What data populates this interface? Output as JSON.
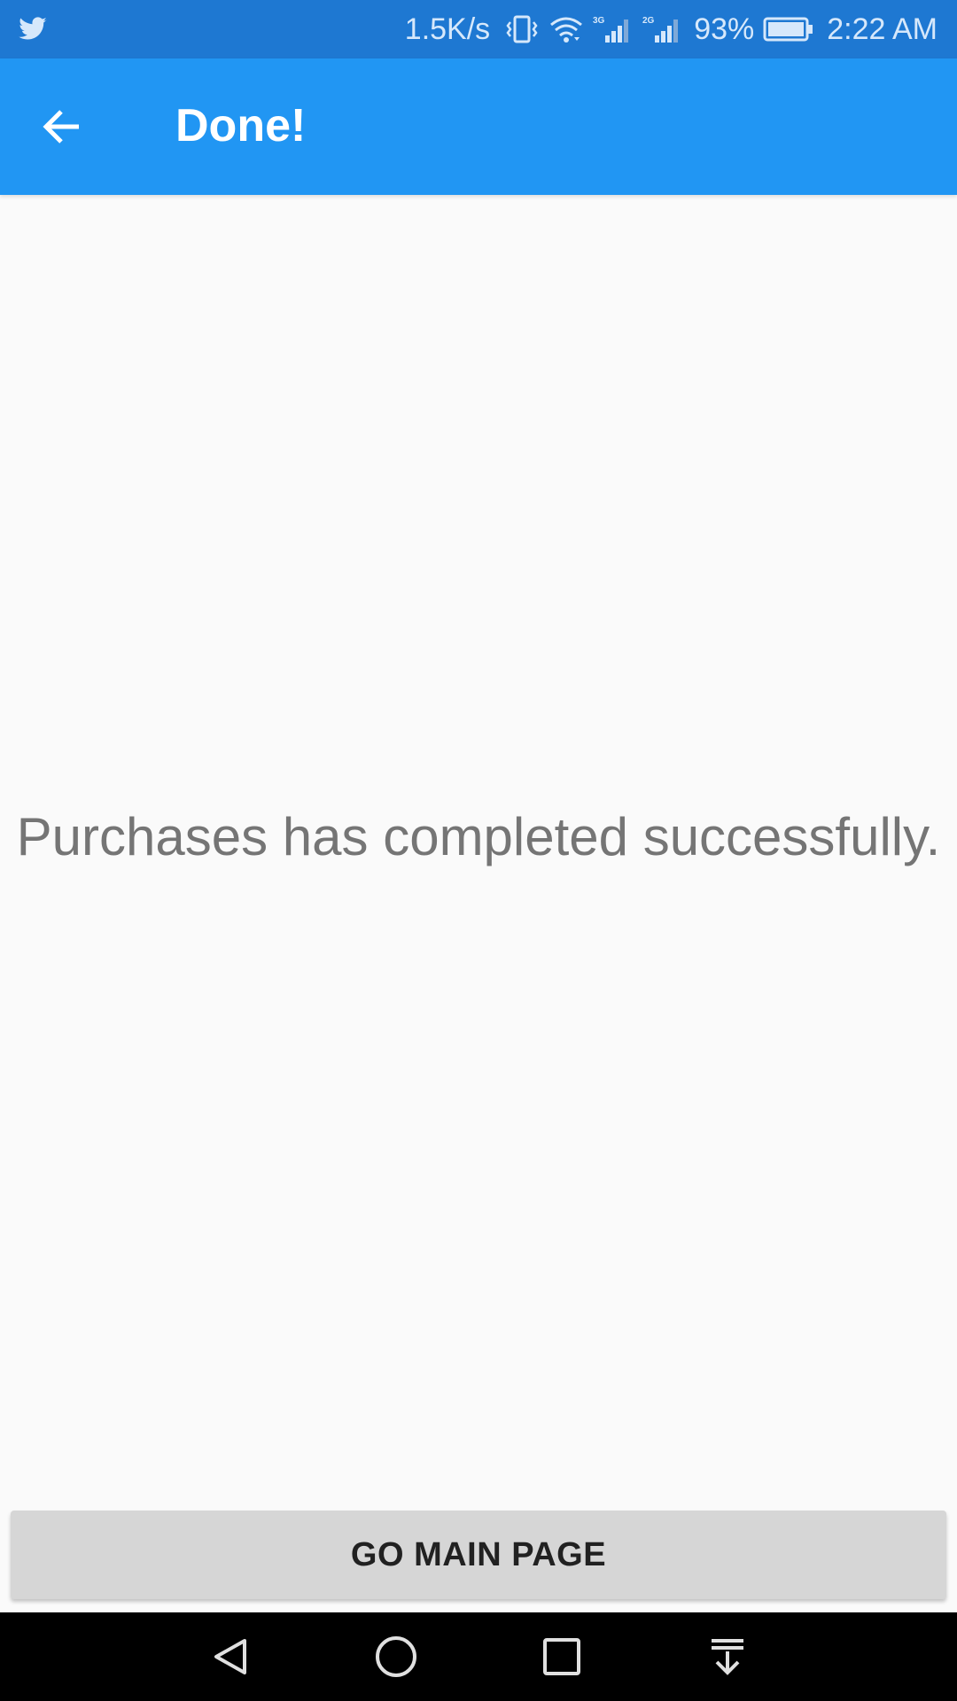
{
  "status_bar": {
    "net_speed": "1.5K/s",
    "sim1_label": "3G",
    "sim2_label": "2G",
    "battery": "93%",
    "time": "2:22 AM",
    "icons": [
      "twitter-icon",
      "vibrate-icon",
      "wifi-icon",
      "signal-icon",
      "battery-icon"
    ]
  },
  "app_bar": {
    "title": "Done!",
    "back_icon": "arrow-back-icon"
  },
  "content": {
    "message": "Purchases has completed successfully."
  },
  "actions": {
    "main_button_label": "GO MAIN PAGE"
  },
  "nav_bar": {
    "icons": [
      "back-triangle-icon",
      "home-circle-icon",
      "recents-square-icon",
      "notifications-pull-icon"
    ]
  },
  "colors": {
    "status_bar": "#1e78d2",
    "app_bar": "#2196f3",
    "background": "#fafafa",
    "message_text": "#757575",
    "button_bg": "#d6d6d6",
    "nav_bar": "#000000"
  }
}
